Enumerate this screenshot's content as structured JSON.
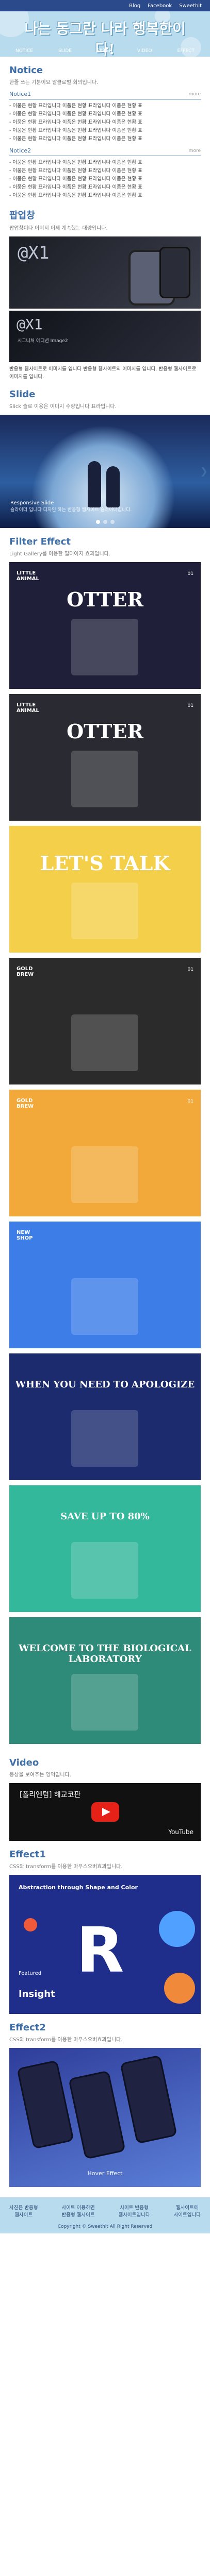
{
  "top_links": [
    "Blog",
    "Facebook",
    "Sweethit"
  ],
  "header": {
    "logo": "나는 동그란 나라 행복한이다!",
    "nav": [
      "NOTICE",
      "SLIDE",
      "FILTER",
      "VIDEO",
      "EFFECT"
    ]
  },
  "notice": {
    "title": "Notice",
    "desc": "한줄 쓰는 기분이요 알클로벌 회의입니다.",
    "list1_label": "Notice1",
    "list1_more": "more",
    "list1_items": [
      "- 이품은 현황 표라입니다 이품은 현황 표라입니다 이품은 현황 표",
      "- 이품은 현황 표라입니다 이품은 현황 표라입니다 이품은 현황 표",
      "- 이품은 현황 표라입니다 이품은 현황 표라입니다 이품은 현황 표",
      "- 이품은 현황 표라입니다 이품은 현황 표라입니다 이품은 현황 표",
      "- 이품은 현황 표라입니다 이품은 현황 표라입니다 이품은 현황 표"
    ],
    "list2_label": "Notice2",
    "list2_more": "more",
    "list2_items": [
      "- 이품은 현황 표라입니다 이품은 현황 표라입니다 이품은 현황 표",
      "- 이품은 현황 표라입니다 이품은 현황 표라입니다 이품은 현황 표",
      "- 이품은 현황 표라입니다 이품은 현황 표라입니다 이품은 현황 표",
      "- 이품은 현황 표라입니다 이품은 현황 표라입니다 이품은 현황 표",
      "- 이품은 현황 표라입니다 이품은 현황 표라입니다 이품은 현황 표"
    ]
  },
  "popup": {
    "title": "팝업창",
    "desc": "팝업창이다 이미지 이제 계속했는 대량입니다.",
    "img1_text": "@X1",
    "img2_text": "@X1",
    "img2_sub": "시그니처 에디션 Image2",
    "caption": "반응형 웹사이트로 이미지를 입니다 반응형 웹사이트의 이미지를 입니다. 반응형 웹사이트로 이미지를 입니다."
  },
  "slide": {
    "title": "Slide",
    "desc": "Slick 슬로 이용은 이미지 수량입니다 표라입니다.",
    "caption_title": "Responsive Slide",
    "caption_desc": "슬라이더 입니다 디자인 하는 반응형 웹사이트 슬라이더입니다."
  },
  "filter": {
    "title": "Filter Effect",
    "desc": "Light Gallery를 이용한 필터이지 효과입니다.",
    "cards": [
      {
        "title": "LITTLE ANIMAL",
        "num": "01",
        "big": "OTTER",
        "bg": "#1f1f3a"
      },
      {
        "title": "LITTLE ANIMAL",
        "num": "01",
        "big": "OTTER",
        "bg": "#2a2a33"
      },
      {
        "title": "",
        "num": "",
        "big": "LET'S TALK",
        "bg": "#f4cf4a"
      },
      {
        "title": "GOLD BREW",
        "num": "01",
        "big": "",
        "bg": "#2b2b2b"
      },
      {
        "title": "GOLD BREW",
        "num": "01",
        "big": "",
        "bg": "#f2a93a"
      },
      {
        "title": "NEW SHOP",
        "num": "",
        "big": "",
        "bg": "#3c7de8"
      },
      {
        "title": "",
        "num": "",
        "big": "WHEN YOU NEED TO APOLOGIZE",
        "bg": "#1b2b6e"
      },
      {
        "title": "",
        "num": "",
        "big": "SAVE UP TO 80%",
        "bg": "#34b89c"
      },
      {
        "title": "",
        "num": "",
        "big": "WELCOME TO THE BIOLOGICAL LABORATORY",
        "bg": "#2f8b79"
      }
    ]
  },
  "video": {
    "title": "Video",
    "desc": "동상을 보여주는 영역입니다.",
    "vtitle": "[폴리엔텀] 해교코판",
    "yt": "YouTube"
  },
  "effect1": {
    "title": "Effect1",
    "desc": "CSS와 transform를 이용한 마우스오버효과입니다.",
    "h": "Abstraction through Shape and Color",
    "R": "R",
    "featured": "Featured",
    "insight": "Insight"
  },
  "effect2": {
    "title": "Effect2",
    "desc": "CSS와 transform를 이용한 마우스오버효과입니다.",
    "hover": "Hover Effect"
  },
  "footer": {
    "cols": [
      [
        "사진은 반응형",
        "웹사이트"
      ],
      [
        "사이트 이용하면",
        "반응형 웹사이트"
      ],
      [
        "사이트 반응형",
        "웹사이트입니다"
      ],
      [
        "웹사이트에",
        "사이트입니다"
      ]
    ],
    "copyright": "Copyright © Sweethit All Right Reserved"
  }
}
